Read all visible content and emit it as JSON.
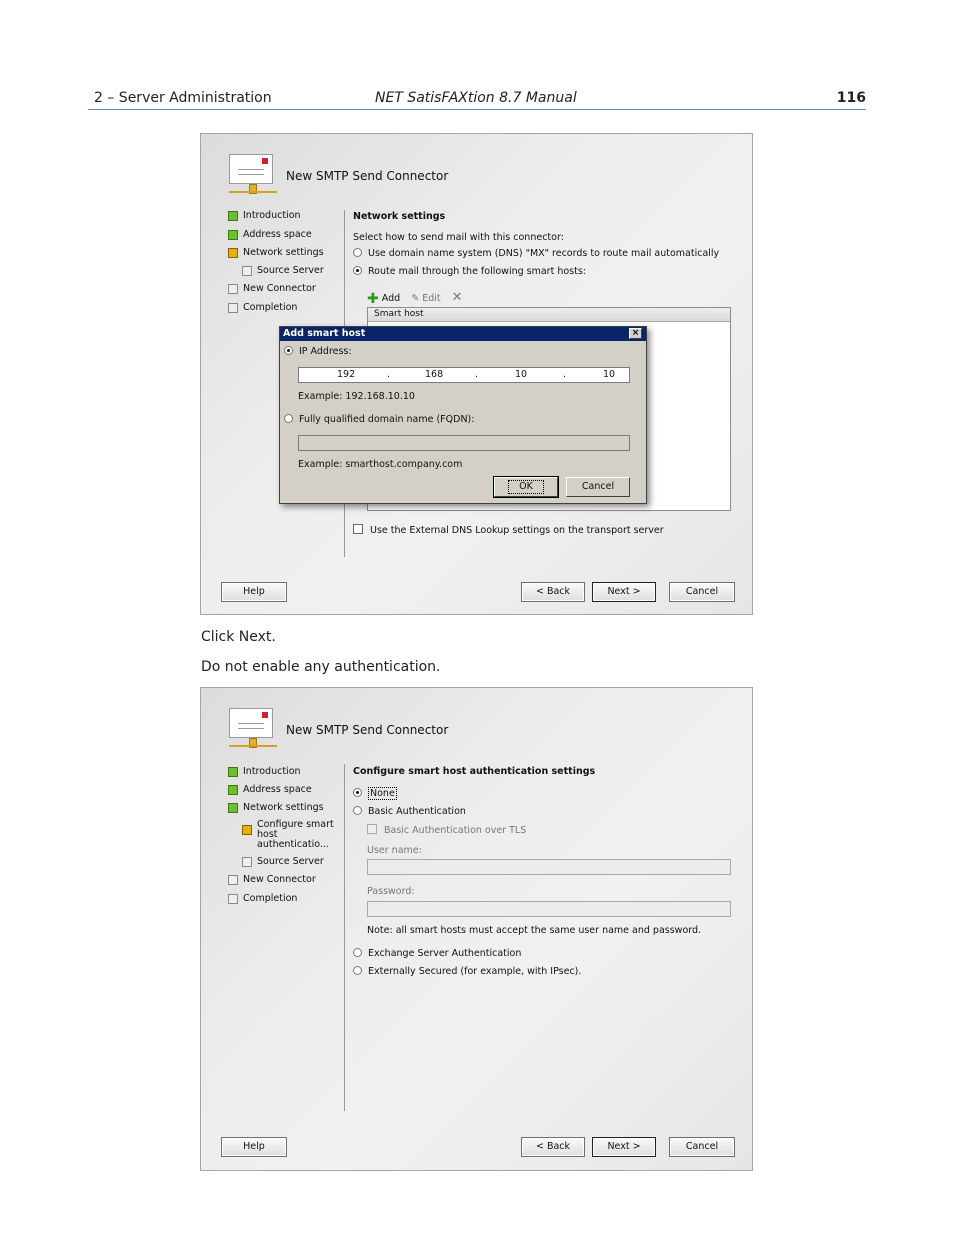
{
  "header": {
    "section": "2 – Server Administration",
    "manual": "NET SatisFAXtion 8.7 Manual",
    "page": "116"
  },
  "captions": {
    "click_next": "Click Next.",
    "no_auth": "Do not enable any authentication."
  },
  "wizard1": {
    "title": "New SMTP Send Connector",
    "steps": [
      "Introduction",
      "Address space",
      "Network settings",
      "Source Server",
      "New Connector",
      "Completion"
    ],
    "heading": "Network settings",
    "prompt": "Select how to send mail with this connector:",
    "option_dns": "Use domain name system (DNS) \"MX\" records to route mail automatically",
    "option_smarthost": "Route mail through the following smart hosts:",
    "toolbar": {
      "add": "Add",
      "edit": "Edit"
    },
    "list_header": "Smart host",
    "external_dns": "Use the External DNS Lookup settings on the transport server",
    "buttons": {
      "help": "Help",
      "back": "< Back",
      "next": "Next >",
      "cancel": "Cancel"
    }
  },
  "dialog": {
    "title": "Add smart host",
    "close": "×",
    "ip_label": "IP Address:",
    "ip": [
      "192",
      "168",
      "10",
      "10"
    ],
    "ip_dot": ".",
    "ip_example": "Example: 192.168.10.10",
    "fqdn_label": "Fully qualified domain name (FQDN):",
    "fqdn_example": "Example: smarthost.company.com",
    "ok": "OK",
    "cancel": "Cancel"
  },
  "wizard2": {
    "title": "New SMTP Send Connector",
    "steps": [
      "Introduction",
      "Address space",
      "Network settings",
      "Configure smart host authenticatio...",
      "Source Server",
      "New Connector",
      "Completion"
    ],
    "heading": "Configure smart host authentication settings",
    "opt_none": "None",
    "opt_basic": "Basic Authentication",
    "opt_basic_tls": "Basic Authentication over TLS",
    "username_label": "User name:",
    "password_label": "Password:",
    "note": "Note: all smart hosts must accept the same user name and password.",
    "opt_exchange": "Exchange Server Authentication",
    "opt_external": "Externally Secured (for example, with IPsec).",
    "buttons": {
      "help": "Help",
      "back": "< Back",
      "next": "Next >",
      "cancel": "Cancel"
    }
  }
}
